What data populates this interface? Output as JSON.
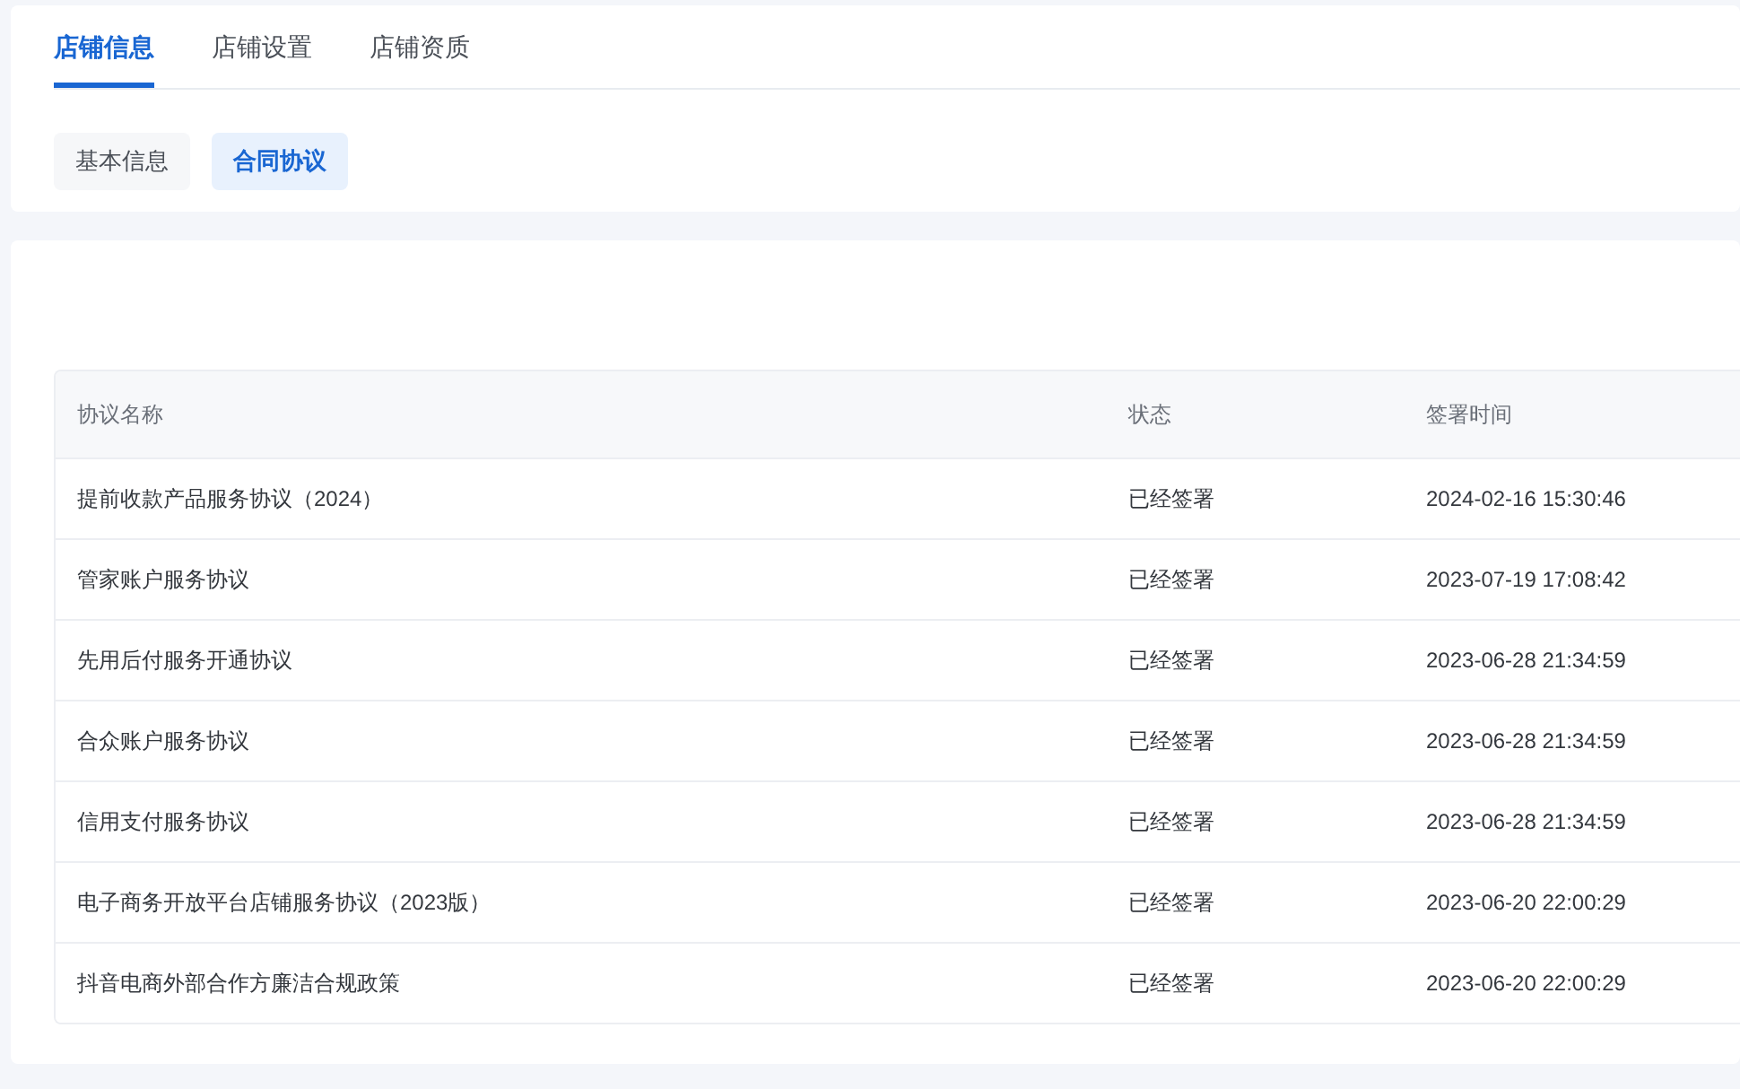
{
  "tabs": [
    {
      "label": "店铺信息",
      "selected": true
    },
    {
      "label": "店铺设置",
      "selected": false
    },
    {
      "label": "店铺资质",
      "selected": false
    }
  ],
  "subtabs": [
    {
      "label": "基本信息",
      "selected": false
    },
    {
      "label": "合同协议",
      "selected": true
    }
  ],
  "table": {
    "columns": [
      "协议名称",
      "状态",
      "签署时间"
    ],
    "rows": [
      [
        "提前收款产品服务协议（2024）",
        "已经签署",
        "2024-02-16 15:30:46"
      ],
      [
        "管家账户服务协议",
        "已经签署",
        "2023-07-19 17:08:42"
      ],
      [
        "先用后付服务开通协议",
        "已经签署",
        "2023-06-28 21:34:59"
      ],
      [
        "合众账户服务协议",
        "已经签署",
        "2023-06-28 21:34:59"
      ],
      [
        "信用支付服务协议",
        "已经签署",
        "2023-06-28 21:34:59"
      ],
      [
        "电子商务开放平台店铺服务协议（2023版）",
        "已经签署",
        "2023-06-20 22:00:29"
      ],
      [
        "抖音电商外部合作方廉洁合规政策",
        "已经签署",
        "2023-06-20 22:00:29"
      ]
    ]
  }
}
